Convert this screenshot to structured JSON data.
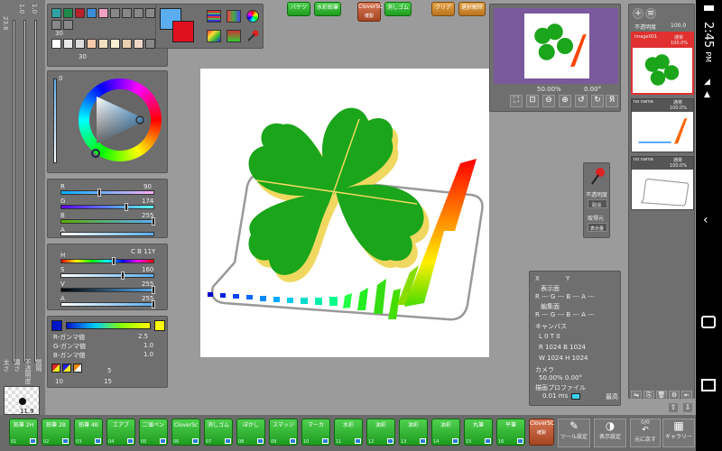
{
  "left_vertical": {
    "top_labels": [
      "23.6",
      "1.0",
      "1.0"
    ],
    "bottom_labels": [
      "太さ",
      "濃さ",
      "不透明度",
      "間隔"
    ],
    "brush_size": "11.9"
  },
  "palette": {
    "colors": [
      "#2fa3a3",
      "#1e8a4a",
      "#b8202a",
      "#3a8fd8",
      "#f0a0c0",
      "#ffffff",
      "#e8e8e8",
      "#dcdcdc",
      "#f8c8a8",
      "#f0e0c0",
      "#f8f0d0",
      "#e8d0b0",
      "#f0d8c8"
    ],
    "count_1": "30",
    "count_2": "30"
  },
  "color": {
    "main": "#5aaef0",
    "sub": "#e01020",
    "ring_value_top": "0",
    "rgb_values": [
      "90",
      "174",
      "255"
    ],
    "rgb_labels": [
      "R",
      "G",
      "B",
      "A"
    ],
    "hsv_labels": [
      "H",
      "S",
      "V",
      "A"
    ],
    "hsv_top": "C B 11Y",
    "hsv_values": [
      "160",
      "255",
      "255"
    ],
    "a_value": "255"
  },
  "gamma": {
    "labels": [
      "R-ガンマ値",
      "G-ガンマ値",
      "B-ガンマ値"
    ],
    "values": [
      "1.0",
      "1.0",
      "1.0"
    ],
    "small_value": "2.5",
    "counts": [
      "10",
      "15",
      "5"
    ]
  },
  "top_buttons": {
    "bucket": "バケツ",
    "watercolor": "水彩鉛筆",
    "cloversc": "CloverSC",
    "cloversc_sub": "確製",
    "brush_tool": "消しゴム",
    "clear": "クリア",
    "select_release": "選択解除"
  },
  "navigator": {
    "zoom": "50.00%",
    "angle": "0.00°"
  },
  "info": {
    "x_label": "X",
    "y_label": "Y",
    "display_label": "表示面",
    "edit_label": "編集面",
    "canvas_label": "キャンバス",
    "r_row": "R --- G --- B --- A ---",
    "canvas_L": "L 0 T 0",
    "canvas_R": "R 1024 B 1024",
    "canvas_W": "W 1024 H 1024",
    "camera_label": "カメラ",
    "camera_vals": "50.00%  0.00°",
    "profile_label": "描画プロファイル",
    "profile_val": "0.01 ms",
    "hint_label": "最高"
  },
  "side_tools": {
    "opacity": "不透明度",
    "cancel": "取消",
    "restore": "取得元",
    "display": "表示量"
  },
  "layers": {
    "header_opacity": "不透明度",
    "header_value": "100.0",
    "items": [
      {
        "name": "image001",
        "mode": "通常",
        "opacity": "100.0%"
      },
      {
        "name": "no name",
        "mode": "通常",
        "opacity": "100.0%"
      },
      {
        "name": "no name",
        "mode": "通常",
        "opacity": "100.0%"
      }
    ]
  },
  "brushes": [
    {
      "label": "鉛筆 2H",
      "num": "01"
    },
    {
      "label": "鉛筆 2B",
      "num": "02"
    },
    {
      "label": "鉛筆 4B",
      "num": "03"
    },
    {
      "label": "エアブ",
      "num": "04"
    },
    {
      "label": "二値ペン",
      "num": "05"
    },
    {
      "label": "CloverSc",
      "num": "06"
    },
    {
      "label": "消しゴム",
      "num": "07"
    },
    {
      "label": "ぼかし",
      "num": "08"
    },
    {
      "label": "スマッジ",
      "num": "09"
    },
    {
      "label": "マーカ",
      "num": "10"
    },
    {
      "label": "水彩",
      "num": "11"
    },
    {
      "label": "油彩",
      "num": "12"
    },
    {
      "label": "油彩",
      "num": "13"
    },
    {
      "label": "油彩",
      "num": "14"
    },
    {
      "label": "丸筆",
      "num": "15"
    },
    {
      "label": "平筆",
      "num": "16"
    }
  ],
  "bottom_right": {
    "cloversc": "CloverSC",
    "cloversc_sub": "確製",
    "tool_settings": "ツール設定",
    "display_settings": "表示設定",
    "undo_count": "0/0",
    "undo": "元に戻す",
    "gallery": "ギャラリー"
  },
  "statusbar": {
    "time": "2:45",
    "pm": "PM"
  }
}
